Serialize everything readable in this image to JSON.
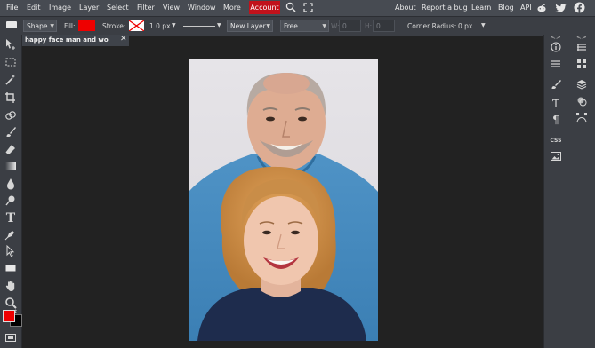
{
  "menu": {
    "items": [
      "File",
      "Edit",
      "Image",
      "Layer",
      "Select",
      "Filter",
      "View",
      "Window",
      "More"
    ],
    "account": "Account",
    "right_links": [
      "About",
      "Report a bug",
      "Learn",
      "Blog",
      "API"
    ]
  },
  "options": {
    "shape_value": "Shape",
    "fill_label": "Fill:",
    "fill_color": "#ee0000",
    "stroke_label": "Stroke:",
    "stroke_width": "1.0 px",
    "layer_value": "New Layer",
    "mode_value": "Free",
    "w_label": "W:",
    "w_value": "0",
    "h_label": "H:",
    "h_value": "0",
    "corner_label": "Corner Radius:",
    "corner_value": "0 px"
  },
  "document_tab": {
    "title": "happy face man and wo",
    "close": "✕"
  },
  "colors": {
    "primary": "#ee0000",
    "secondary": "#000000",
    "accent_account": "#c1121b"
  },
  "right_panel": {
    "css_label": "CSS",
    "expand": "<>"
  }
}
